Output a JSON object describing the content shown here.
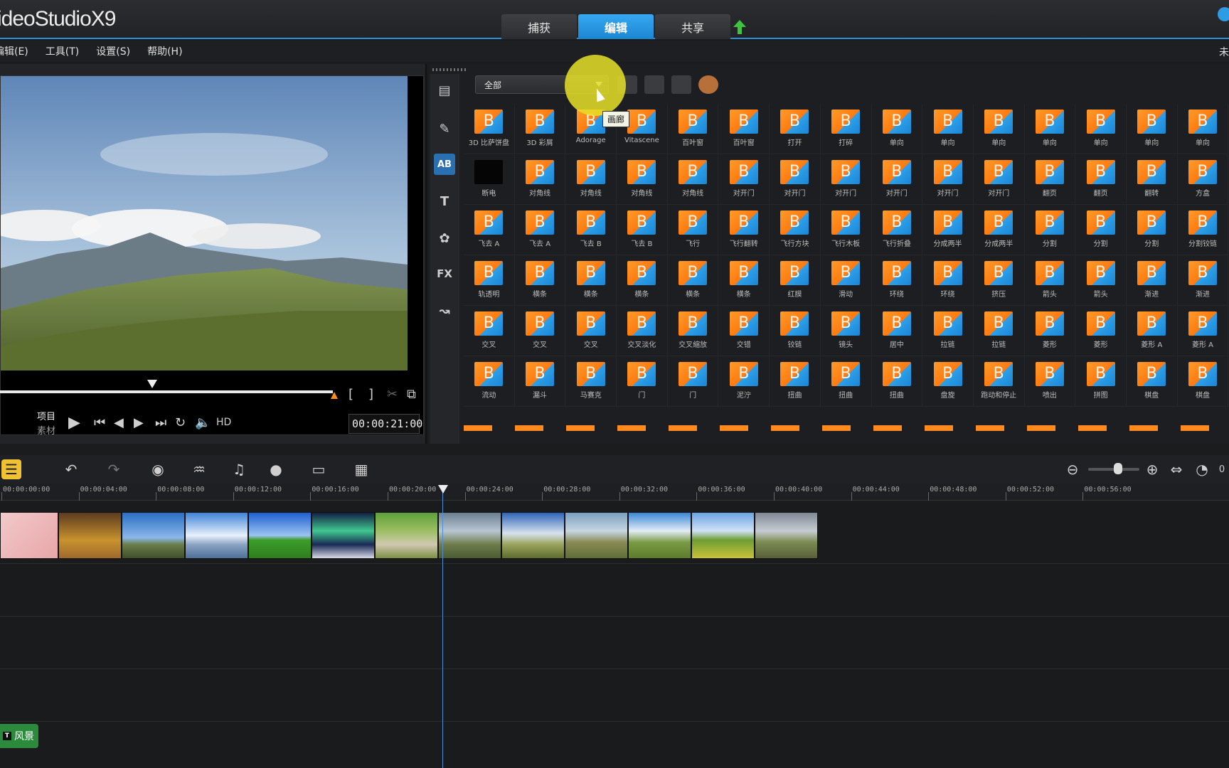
{
  "app": {
    "title": "ideoStudioX9"
  },
  "tabs": [
    {
      "label": "捕获"
    },
    {
      "label": "编辑"
    },
    {
      "label": "共享"
    }
  ],
  "menu": {
    "items": [
      {
        "label": "编辑(E)"
      },
      {
        "label": "工具(T)"
      },
      {
        "label": "设置(S)"
      },
      {
        "label": "帮助(H)"
      }
    ],
    "right": "未"
  },
  "preview": {
    "project_label": "项目",
    "clip_label": "素材",
    "timecode": "00:00:21:00",
    "hd": "HD",
    "progress": 0.78
  },
  "library": {
    "dropdown_value": "全部",
    "tooltip": "画廊",
    "sidebar": [
      "media",
      "instant-project",
      "transition",
      "title",
      "graphic",
      "FX",
      "path"
    ],
    "items": [
      "3D 比萨饼盘",
      "3D 彩屑",
      "Adorage",
      "Vitascene",
      "百叶窗",
      "百叶窗",
      "打开",
      "打碎",
      "单向",
      "单向",
      "单向",
      "单向",
      "单向",
      "单向",
      "单向",
      "断电",
      "对角线",
      "对角线",
      "对角线",
      "对角线",
      "对开门",
      "对开门",
      "对开门",
      "对开门",
      "对开门",
      "对开门",
      "翻页",
      "翻页",
      "翻转",
      "方盒",
      "飞去 A",
      "飞去 A",
      "飞去 B",
      "飞去 B",
      "飞行",
      "飞行翻转",
      "飞行方块",
      "飞行木板",
      "飞行折叠",
      "分成两半",
      "分成两半",
      "分割",
      "分割",
      "分割",
      "分割铰链",
      "轨透明",
      "横条",
      "横条",
      "横条",
      "横条",
      "横条",
      "红膜",
      "滑动",
      "环绕",
      "环绕",
      "挤压",
      "箭头",
      "箭头",
      "渐进",
      "渐进",
      "交叉",
      "交叉",
      "交叉",
      "交叉淡化",
      "交叉缩放",
      "交错",
      "铰链",
      "镜头",
      "居中",
      "拉链",
      "拉链",
      "菱形",
      "菱形",
      "菱形 A",
      "菱形 A",
      "流动",
      "漏斗",
      "马赛克",
      "门",
      "门",
      "泥泞",
      "扭曲",
      "扭曲",
      "扭曲",
      "盘旋",
      "跑动和停止",
      "喷出",
      "拼图",
      "棋盘",
      "棋盘"
    ]
  },
  "timeline": {
    "ruler": [
      "00:00:00:00",
      "00:00:04:00",
      "00:00:08:00",
      "00:00:12:00",
      "00:00:16:00",
      "00:00:20:00",
      "00:00:24:00",
      "00:00:28:00",
      "00:00:32:00",
      "00:00:36:00",
      "00:00:40:00",
      "00:00:44:00",
      "00:00:48:00",
      "00:00:52:00",
      "00:00:56:00"
    ],
    "title_clip": "风景",
    "zoom_partial": "0"
  },
  "colors": {
    "accent": "#2d8fd6",
    "orange": "#ff8a1f",
    "highlight": "#e6e128",
    "title_clip": "#2c8a3c"
  }
}
